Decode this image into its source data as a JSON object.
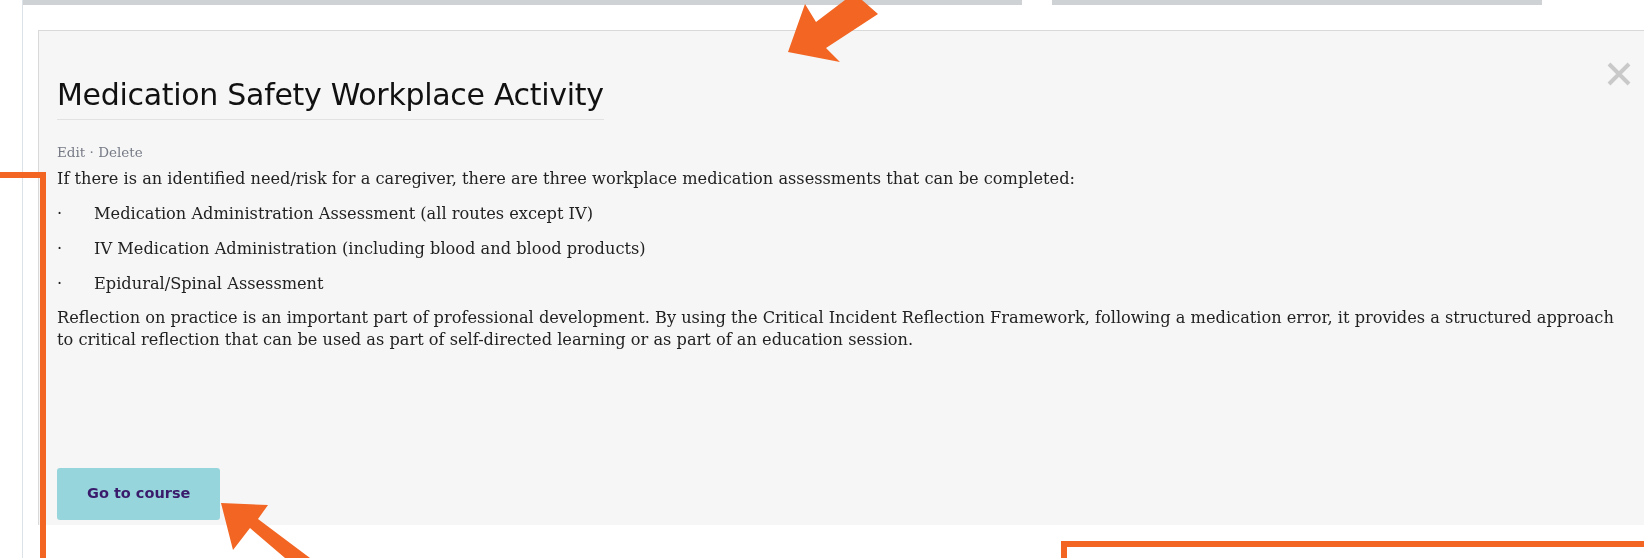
{
  "dialog": {
    "title": "Medication Safety Workplace Activity",
    "actions": [
      {
        "label": "Edit"
      },
      {
        "label": "Delete"
      }
    ],
    "separator": "·",
    "intro": "If there is an identified need/risk for a caregiver, there are three workplace medication assessments that can be completed:",
    "bullets": [
      {
        "marker": "·",
        "text": "Medication Administration Assessment (all routes except IV)"
      },
      {
        "marker": "·",
        "text": "IV Medication Administration (including blood and blood products)"
      },
      {
        "marker": "·",
        "text": "Epidural/Spinal Assessment"
      }
    ],
    "body": "Reflection on practice is an important part of professional development. By using the Critical Incident Reflection Framework, following a medication error, it provides a structured approach to critical reflection that can be used as part of self-directed learning or as part of an education session.",
    "button": {
      "label": "Go to course"
    }
  },
  "annotations": [
    {
      "kind": "arrow-down-left"
    },
    {
      "kind": "arrow-up-left"
    },
    {
      "kind": "frame-left"
    },
    {
      "kind": "frame-bottom"
    }
  ]
}
